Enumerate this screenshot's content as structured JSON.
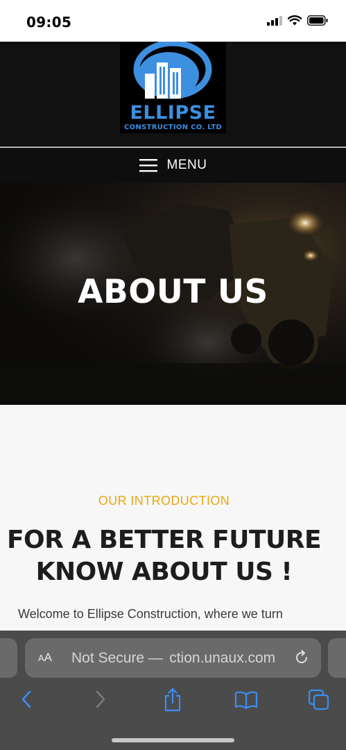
{
  "status_bar": {
    "time": "09:05",
    "icons": [
      "signal-icon",
      "wifi-icon",
      "battery-icon"
    ]
  },
  "header": {
    "logo": {
      "title": "ELLIPSE",
      "subtitle": "CONSTRUCTION CO. LTD",
      "accent_color": "#3d8fe0"
    },
    "menu_label": "MENU"
  },
  "hero": {
    "title": "ABOUT US"
  },
  "intro": {
    "eyebrow": "OUR INTRODUCTION",
    "headline_line1": "FOR A BETTER FUTURE",
    "headline_line2": "KNOW ABOUT US !",
    "text": "Welcome to Ellipse Construction, where we turn",
    "eyebrow_color": "#e8a80f"
  },
  "browser": {
    "text_size_label": "AA",
    "address": "Not Secure —  ction.unaux.com",
    "icons": [
      "back-icon",
      "forward-icon",
      "share-icon",
      "bookmarks-icon",
      "tabs-icon"
    ],
    "accent_color": "#3a8ef6"
  }
}
